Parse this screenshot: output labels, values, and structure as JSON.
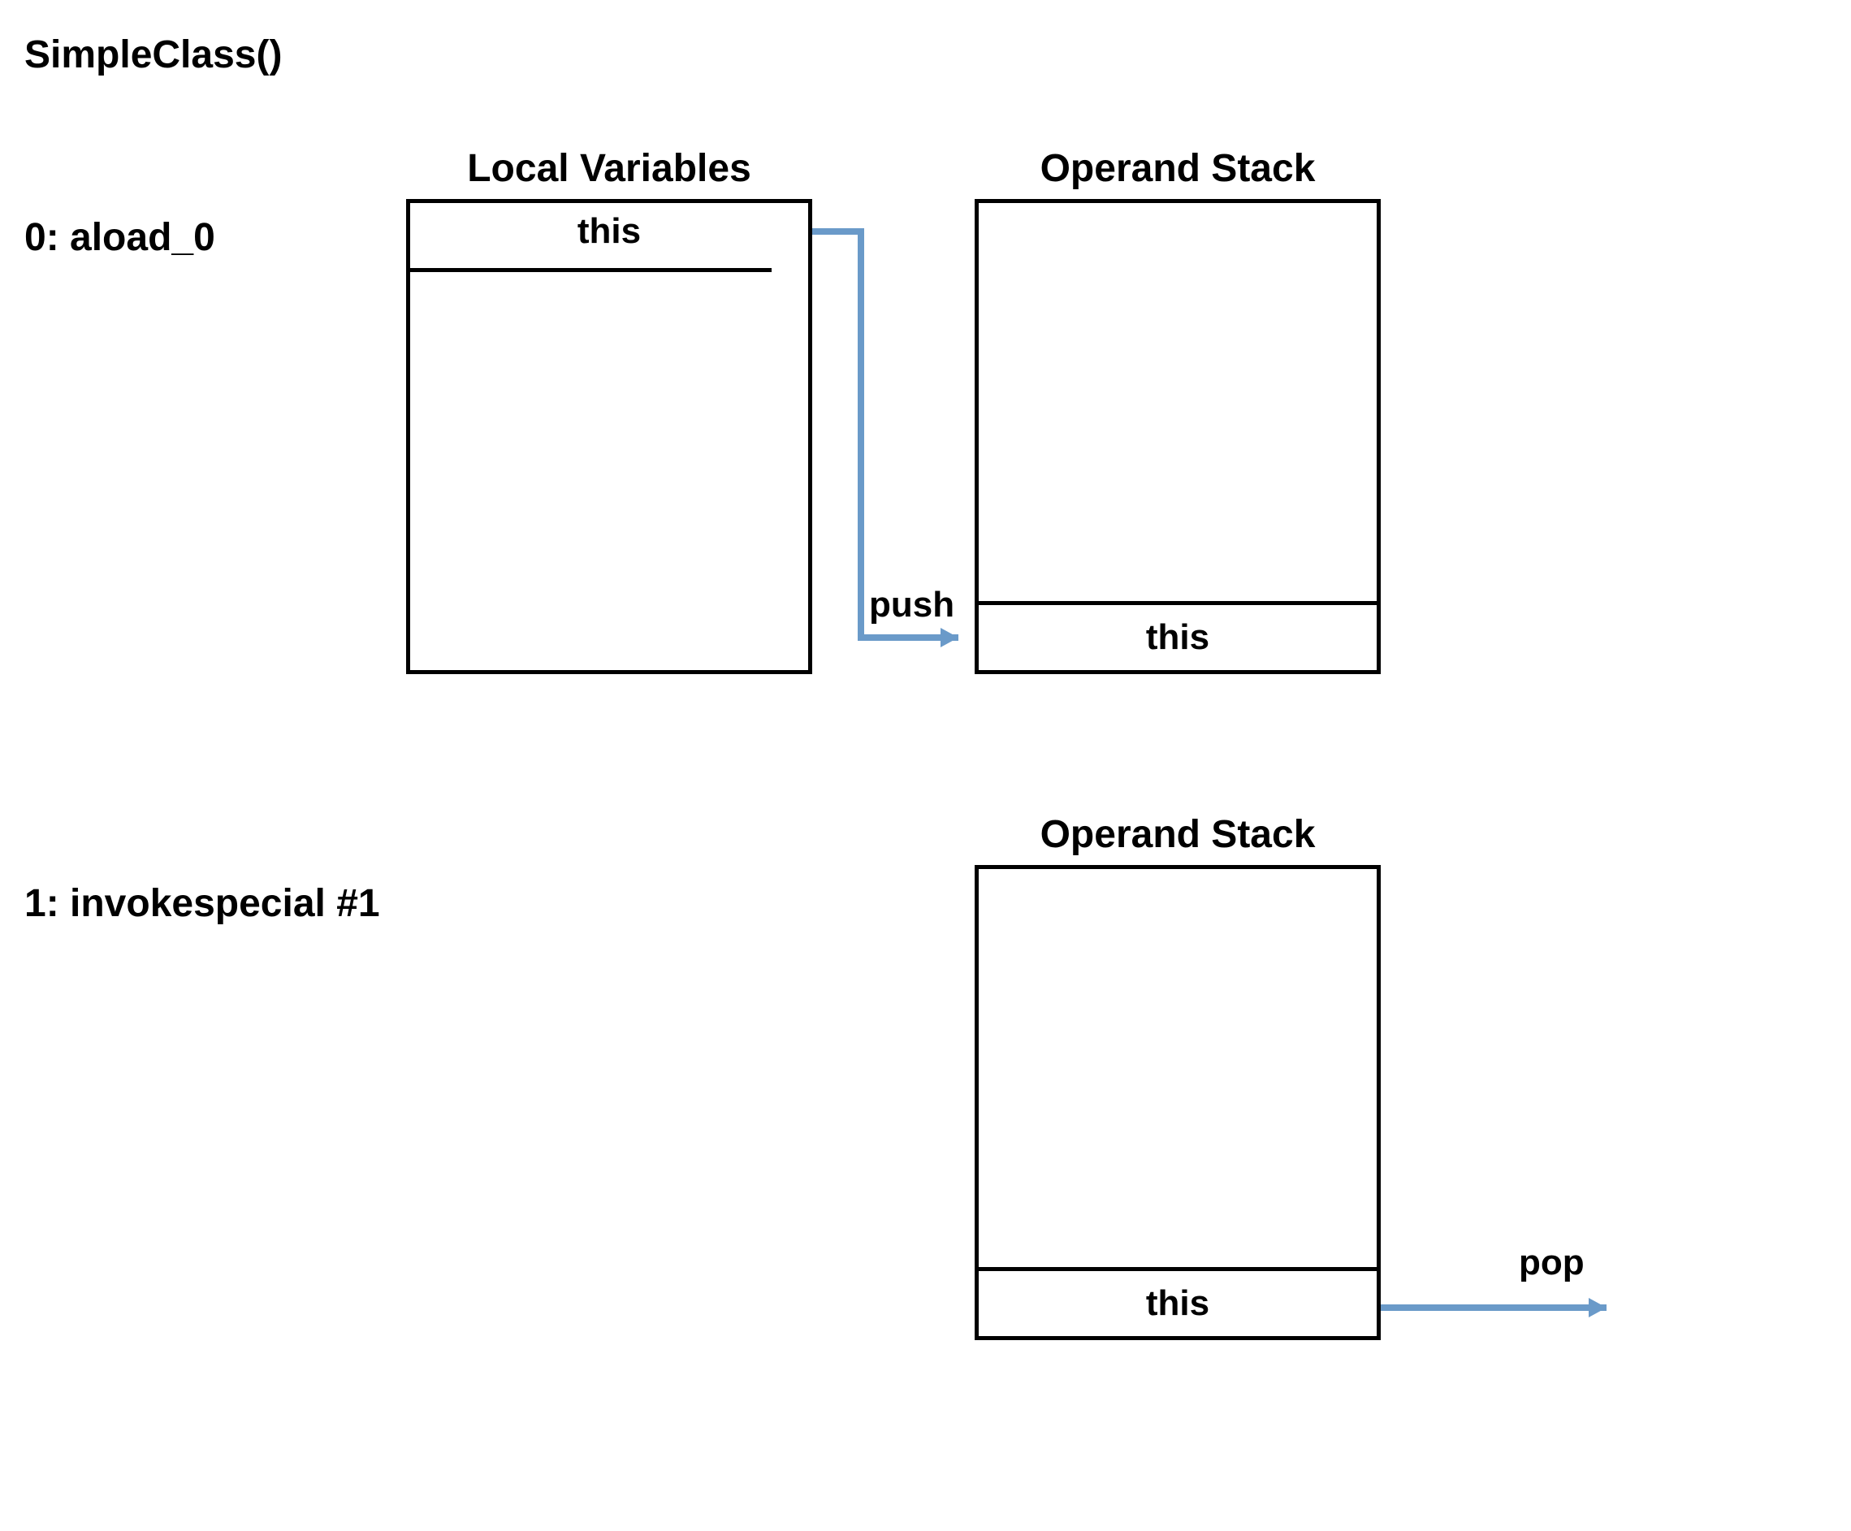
{
  "title": "SimpleClass()",
  "instructions": [
    {
      "label": "0: aload_0"
    },
    {
      "label": "1: invokespecial #1"
    }
  ],
  "section1": {
    "localVars": {
      "title": "Local Variables",
      "slot0": "this"
    },
    "operandStack": {
      "title": "Operand Stack",
      "bottom": "this"
    },
    "arrowLabel": "push"
  },
  "section2": {
    "operandStack": {
      "title": "Operand Stack",
      "bottom": "this"
    },
    "arrowLabel": "pop"
  },
  "colors": {
    "arrow": "#6a9ac9"
  }
}
